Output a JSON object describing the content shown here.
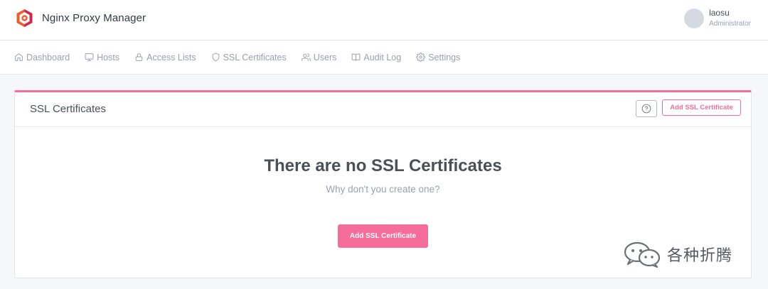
{
  "app": {
    "title": "Nginx Proxy Manager"
  },
  "user": {
    "name": "laosu",
    "role": "Administrator"
  },
  "nav": {
    "items": [
      {
        "label": "Dashboard",
        "icon": "home-icon"
      },
      {
        "label": "Hosts",
        "icon": "monitor-icon"
      },
      {
        "label": "Access Lists",
        "icon": "lock-icon"
      },
      {
        "label": "SSL Certificates",
        "icon": "shield-icon"
      },
      {
        "label": "Users",
        "icon": "users-icon"
      },
      {
        "label": "Audit Log",
        "icon": "book-icon"
      },
      {
        "label": "Settings",
        "icon": "gear-icon"
      }
    ]
  },
  "card": {
    "title": "SSL Certificates",
    "add_button_label": "Add SSL Certificate",
    "empty_title": "There are no SSL Certificates",
    "empty_subtitle": "Why don't you create one?",
    "empty_button_label": "Add SSL Certificate"
  },
  "watermark": {
    "text": "各种折腾"
  },
  "colors": {
    "accent": "#f66d9b",
    "background": "#f5f7fb",
    "muted_text": "#9aa0ac"
  }
}
